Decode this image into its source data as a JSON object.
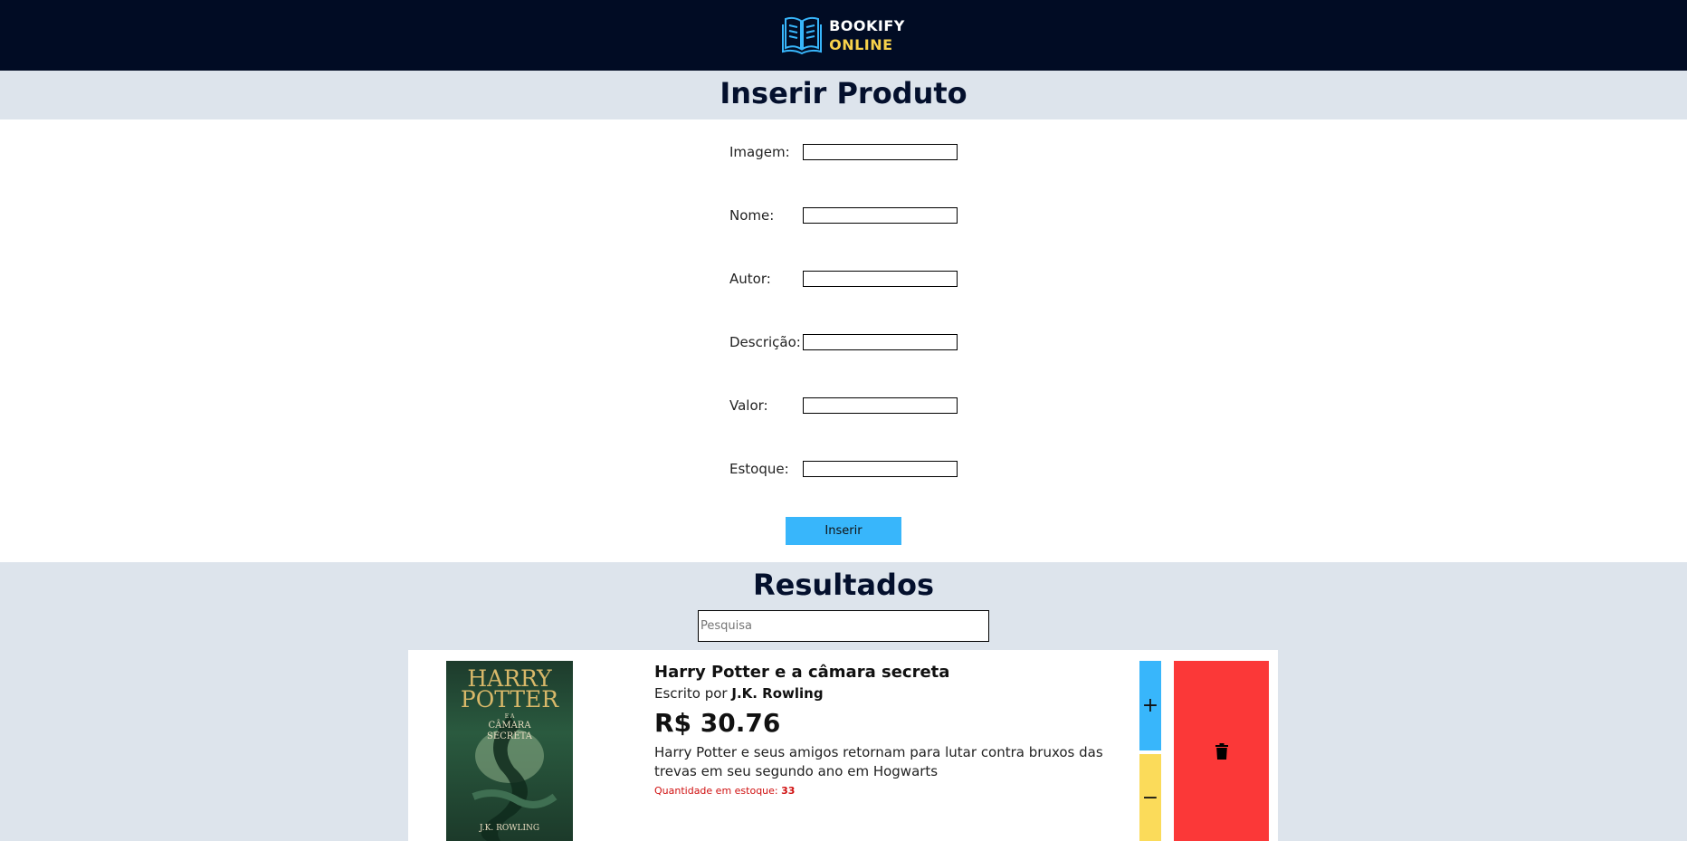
{
  "brand": {
    "line1": "BOOKIFY",
    "line2": "ONLINE",
    "logo_icon": "open-book-icon",
    "colors": {
      "header_bg": "#010c24",
      "accent_blue": "#38b6fb",
      "accent_yellow": "#f7d24b"
    }
  },
  "insert": {
    "title": "Inserir Produto",
    "fields": [
      {
        "label": "Imagem:",
        "value": ""
      },
      {
        "label": "Nome:",
        "value": ""
      },
      {
        "label": "Autor:",
        "value": ""
      },
      {
        "label": "Descrição:",
        "value": ""
      },
      {
        "label": "Valor:",
        "value": ""
      },
      {
        "label": "Estoque:",
        "value": ""
      }
    ],
    "submit_label": "Inserir"
  },
  "results": {
    "title": "Resultados",
    "search_placeholder": "Pesquisa",
    "items": [
      {
        "cover": {
          "title_line1": "HARRY",
          "title_line2": "POTTER",
          "subtitle_line1": "E A",
          "subtitle_line2": "CÂMARA",
          "subtitle_line3": "SECRETA",
          "author": "J.K. ROWLING"
        },
        "title": "Harry Potter e a câmara secreta",
        "author_prefix": "Escrito por",
        "author": "J.K. Rowling",
        "price": "R$ 30.76",
        "description": "Harry Potter e seus amigos retornam para lutar contra bruxos das trevas em seu segundo ano em Hogwarts",
        "stock_label": "Quantidade em estoque:",
        "stock_value": "33",
        "plus_symbol": "+",
        "minus_symbol": "−",
        "delete_icon": "trash-icon"
      }
    ]
  }
}
